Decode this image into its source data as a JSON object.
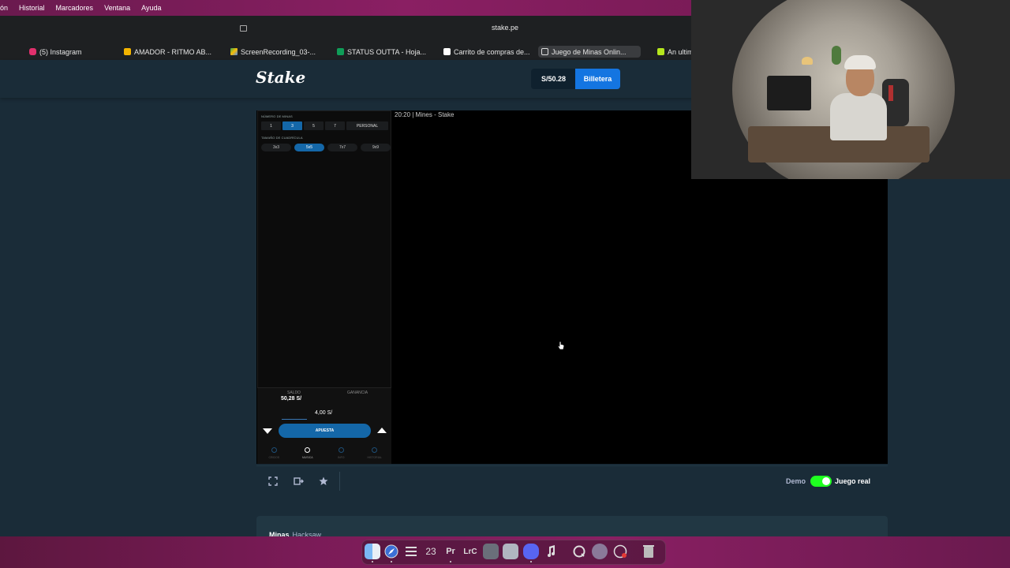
{
  "menubar": {
    "items": [
      "ón",
      "Historial",
      "Marcadores",
      "Ventana",
      "Ayuda"
    ]
  },
  "browser": {
    "address": "stake.pe",
    "bookmarks": [
      {
        "label": "(5) Instagram",
        "icon": "instagram-icon",
        "color": "#e1306c"
      },
      {
        "label": "AMADOR - RITMO AB...",
        "icon": "slides-icon",
        "color": "#f4b400"
      },
      {
        "label": "ScreenRecording_03-...",
        "icon": "drive-icon",
        "color": "#34a853"
      },
      {
        "label": "STATUS OUTTA - Hoja...",
        "icon": "sheets-icon",
        "color": "#0f9d58"
      },
      {
        "label": "Carrito de compras de...",
        "icon": "amazon-icon",
        "color": "#ffffff"
      },
      {
        "label": "Juego de Minas Onlin...",
        "icon": "stake-tab-icon",
        "color": "#ffffff"
      },
      {
        "label": "An ultim",
        "icon": "percent-icon",
        "color": "#b5e61d"
      }
    ]
  },
  "header": {
    "logo": "Stake",
    "balance": "S/50.28",
    "wallet_label": "Billetera",
    "accent": "#1475e1"
  },
  "game": {
    "title": "20:20  |  Mines - Stake",
    "mines_label": "NÚMERO DE MINAS",
    "mines_options": [
      "1",
      "3",
      "5",
      "7",
      "PERSONAL"
    ],
    "mines_selected": "3",
    "grid_label": "TAMAÑO DE CUADRÍCULA",
    "grid_options": [
      "3x3",
      "5x5",
      "7x7",
      "9x9"
    ],
    "grid_selected": "5x5",
    "saldo_label": "SALDO",
    "saldo_value": "50,28 S/",
    "ganancia_label": "GANANCIA",
    "bet_amount": "4,00 S/",
    "bet_button": "APUESTA",
    "tabs": [
      {
        "label": "CRIDOS",
        "icon": "dot-icon",
        "active": false
      },
      {
        "label": "MUSICA",
        "icon": "music-icon",
        "active": true
      },
      {
        "label": "INFO",
        "icon": "info-icon",
        "active": false
      },
      {
        "label": "HISTORIAL",
        "icon": "history-icon",
        "active": false
      }
    ]
  },
  "footer": {
    "demo_label": "Demo",
    "real_label": "Juego real",
    "toggle_color": "#1fff20"
  },
  "below": {
    "title": "Minas",
    "subtitle": "Hacksaw"
  },
  "dock": {
    "items": [
      "finder-icon",
      "safari-icon",
      "launchpad-icon",
      "calendar-icon",
      "premiere-icon",
      "lightroom-icon",
      "app-icon",
      "app-icon-2",
      "discord-icon",
      "music-icon",
      "quicktime-icon",
      "app-icon-3",
      "activity-icon",
      "trash-icon"
    ],
    "calendar_day": "23",
    "premiere_label": "Pr",
    "lightroom_label": "LrC"
  }
}
